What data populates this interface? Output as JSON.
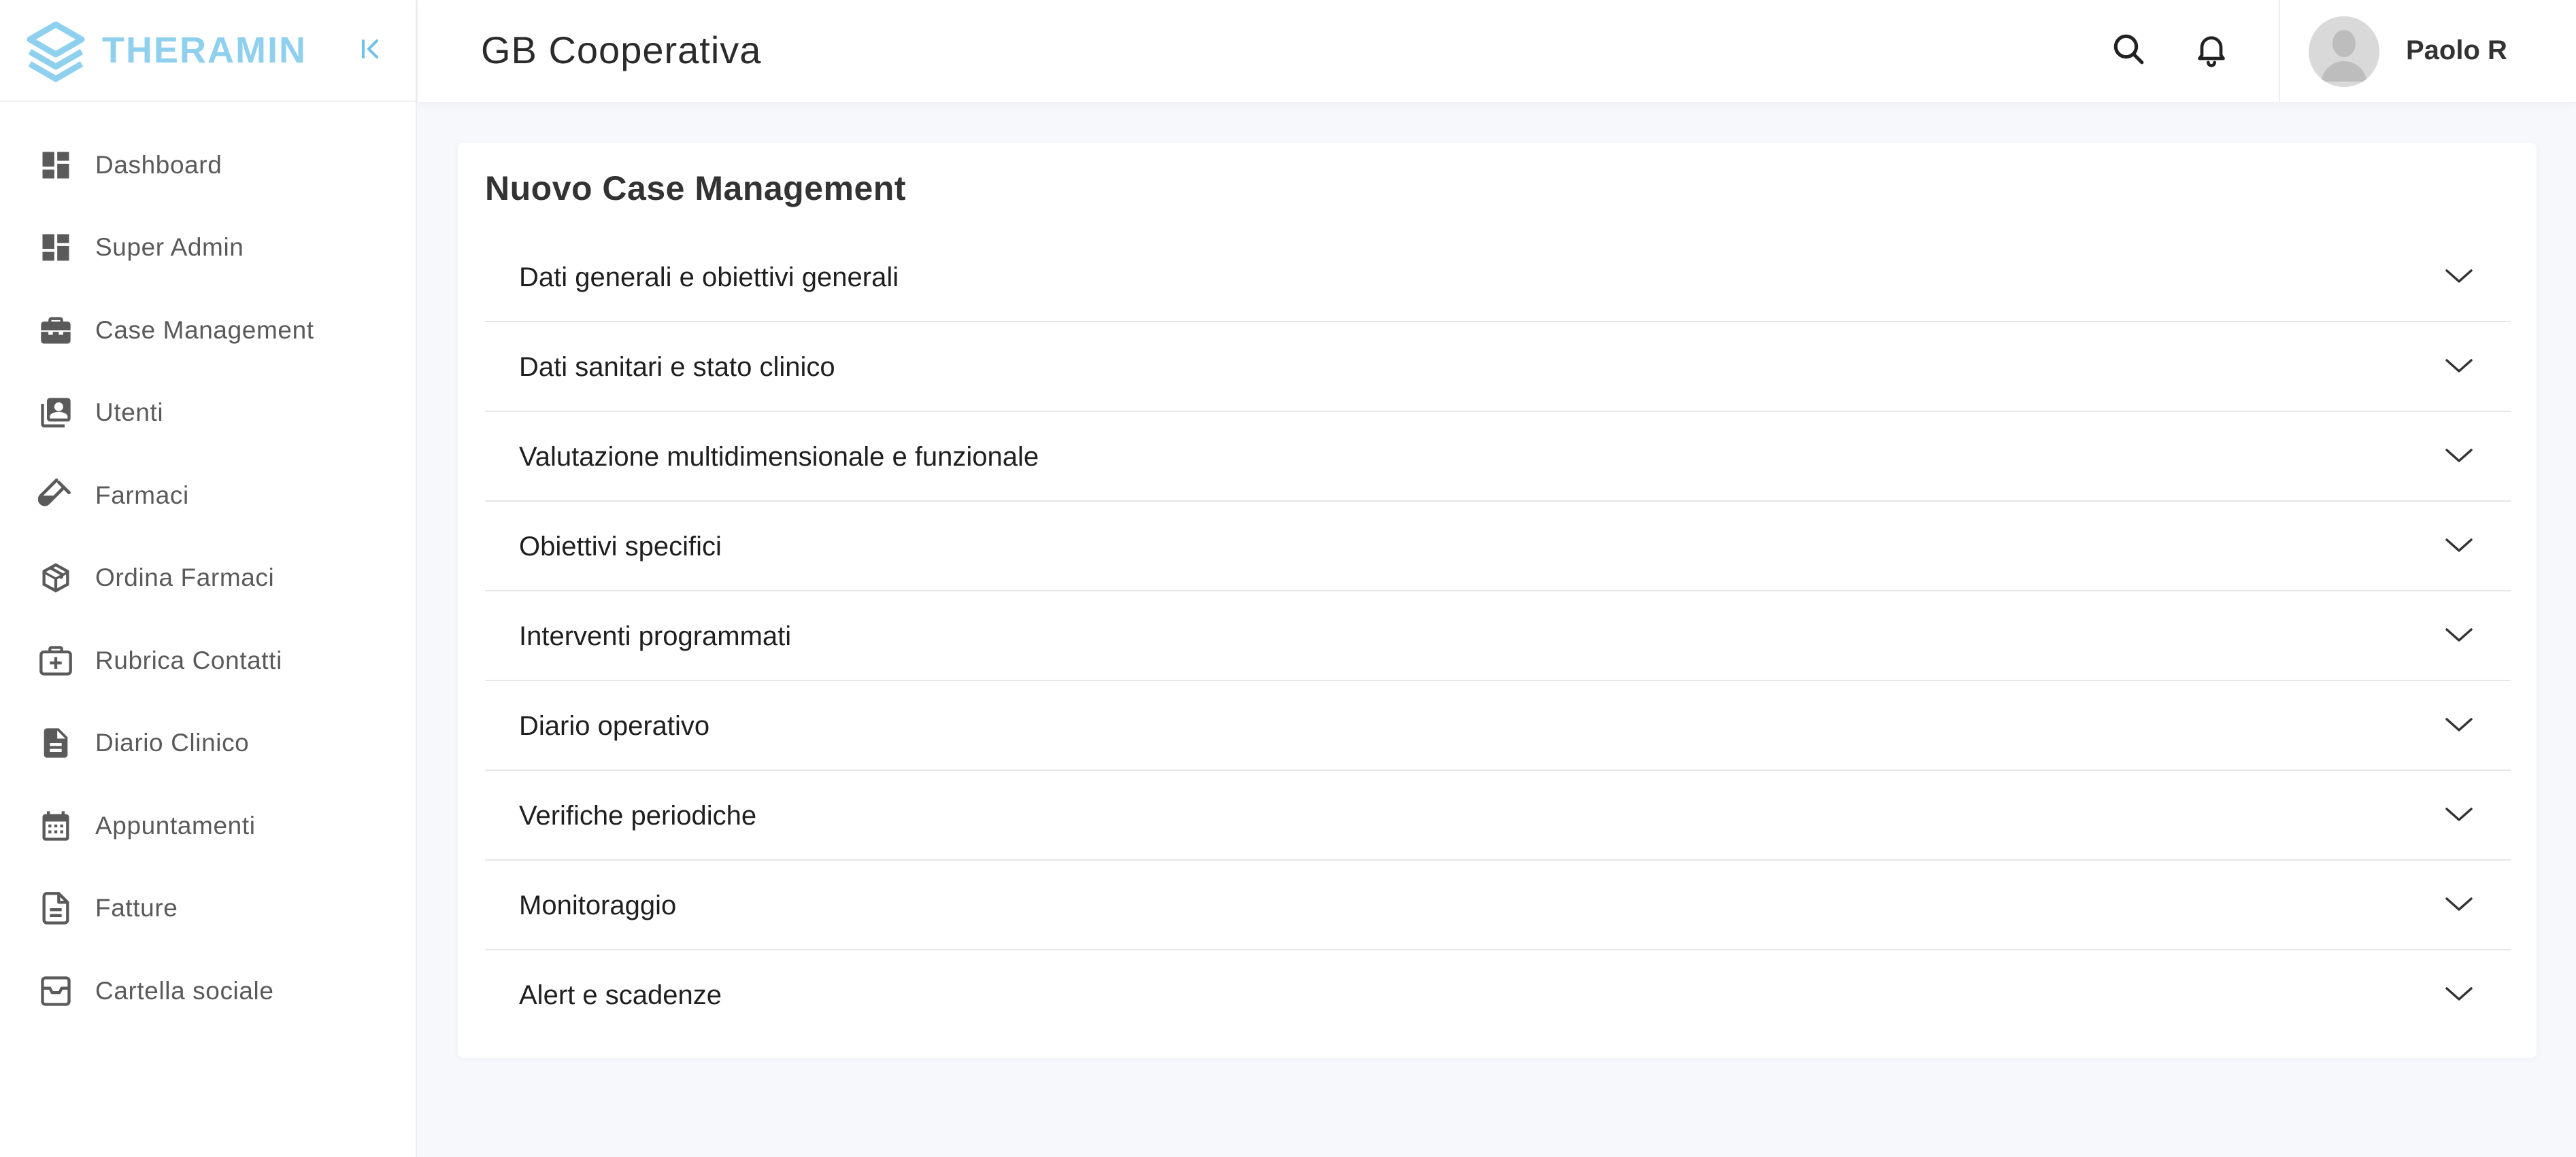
{
  "brand": {
    "name": "THERAMIN",
    "color": "#8fd0ee",
    "logo_icon": "theramin-logo-icon",
    "collapse_icon": "collapse-sidebar-icon"
  },
  "sidebar": {
    "items": [
      {
        "label": "Dashboard",
        "icon": "dashboard-icon"
      },
      {
        "label": "Super Admin",
        "icon": "dashboard-icon"
      },
      {
        "label": "Case Management",
        "icon": "briefcase-icon"
      },
      {
        "label": "Utenti",
        "icon": "contacts-book-icon"
      },
      {
        "label": "Farmaci",
        "icon": "test-tube-icon"
      },
      {
        "label": "Ordina Farmaci",
        "icon": "package-icon"
      },
      {
        "label": "Rubrica Contatti",
        "icon": "medical-kit-icon"
      },
      {
        "label": "Diario Clinico",
        "icon": "document-icon"
      },
      {
        "label": "Appuntamenti",
        "icon": "calendar-icon"
      },
      {
        "label": "Fatture",
        "icon": "invoice-icon"
      },
      {
        "label": "Cartella sociale",
        "icon": "archive-box-icon"
      }
    ]
  },
  "header": {
    "title": "GB Cooperativa",
    "search_icon": "search-icon",
    "notification_icon": "bell-icon",
    "user": {
      "name": "Paolo R",
      "avatar_icon": "avatar-icon"
    }
  },
  "main": {
    "title": "Nuovo Case Management",
    "sections": [
      {
        "label": "Dati generali e obiettivi generali"
      },
      {
        "label": "Dati sanitari e stato clinico"
      },
      {
        "label": "Valutazione multidimensionale e funzionale"
      },
      {
        "label": "Obiettivi specifici"
      },
      {
        "label": "Interventi programmati"
      },
      {
        "label": "Diario operativo"
      },
      {
        "label": "Verifiche periodiche"
      },
      {
        "label": "Monitoraggio"
      },
      {
        "label": "Alert e scadenze"
      }
    ]
  }
}
